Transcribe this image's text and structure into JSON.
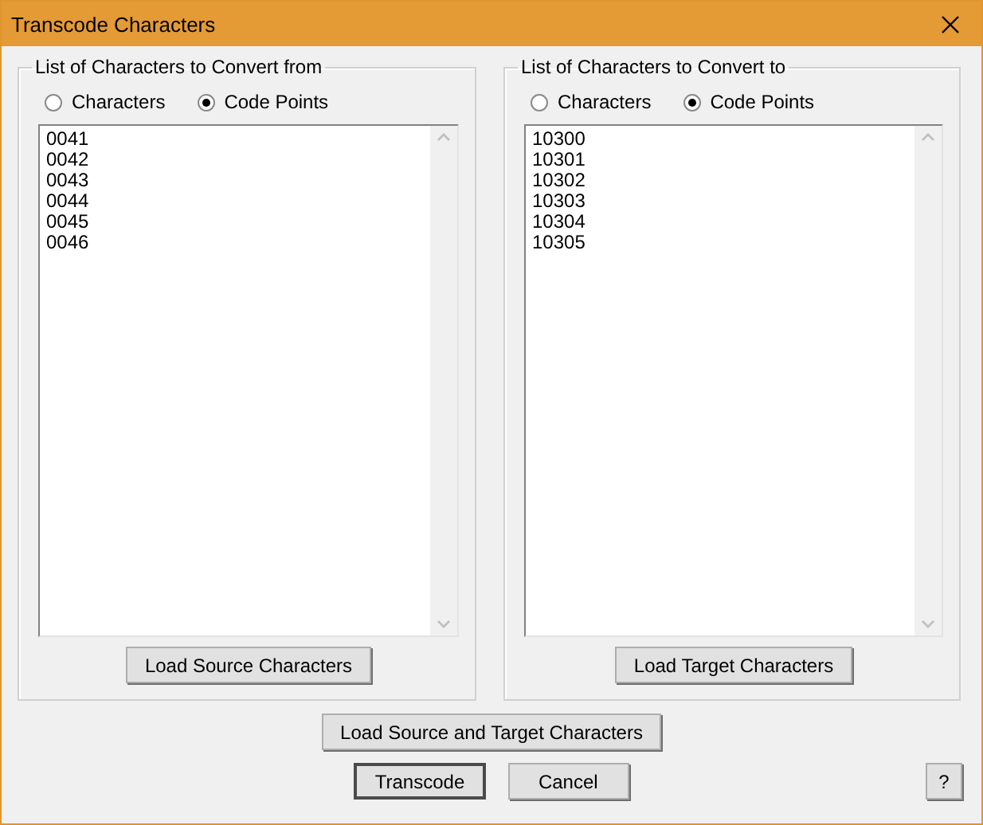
{
  "window": {
    "title": "Transcode Characters"
  },
  "groups": [
    {
      "legend": "List of Characters to Convert from",
      "options": [
        {
          "label": "Characters",
          "selected": false
        },
        {
          "label": "Code Points",
          "selected": true
        }
      ],
      "lines": [
        "0041",
        "0042",
        "0043",
        "0044",
        "0045",
        "0046"
      ],
      "button": "Load Source Characters"
    },
    {
      "legend": "List of Characters to Convert to",
      "options": [
        {
          "label": "Characters",
          "selected": false
        },
        {
          "label": "Code Points",
          "selected": true
        }
      ],
      "lines": [
        "10300",
        "10301",
        "10302",
        "10303",
        "10304",
        "10305"
      ],
      "button": "Load Target Characters"
    }
  ],
  "load_both_button": "Load Source and Target Characters",
  "buttons": [
    {
      "label": "Transcode",
      "default": true
    },
    {
      "label": "Cancel",
      "default": false
    }
  ],
  "help_button": "?"
}
